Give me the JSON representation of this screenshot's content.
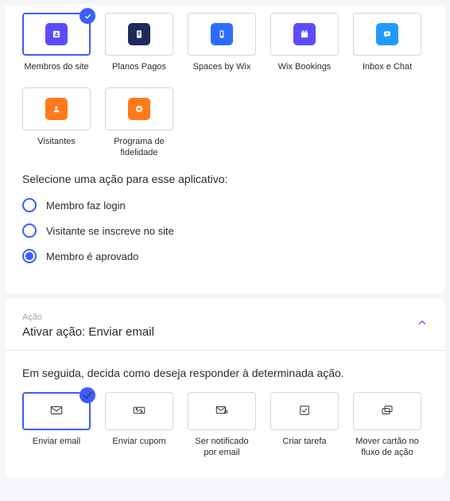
{
  "apps": {
    "title": "Selecione uma ação para esse aplicativo:",
    "items": [
      {
        "label": "Membros do site",
        "icon": "people-icon",
        "color": "bg-purple",
        "selected": true
      },
      {
        "label": "Planos Pagos",
        "icon": "doc-icon",
        "color": "bg-darkblue",
        "selected": false
      },
      {
        "label": "Spaces by Wix",
        "icon": "phone-icon",
        "color": "bg-blue",
        "selected": false
      },
      {
        "label": "Wix Bookings",
        "icon": "calendar-icon",
        "color": "bg-indigo",
        "selected": false
      },
      {
        "label": "Inbox e Chat",
        "icon": "chat-icon",
        "color": "bg-cyan",
        "selected": false
      },
      {
        "label": "Visitantes",
        "icon": "avatar-icon",
        "color": "bg-orange",
        "selected": false
      },
      {
        "label": "Programa de fidelidade",
        "icon": "badge-icon",
        "color": "bg-orange",
        "selected": false
      }
    ],
    "radios": [
      {
        "label": "Membro faz login",
        "checked": false
      },
      {
        "label": "Visitante se inscreve no site",
        "checked": false
      },
      {
        "label": "Membro é aprovado",
        "checked": true
      }
    ]
  },
  "action_panel": {
    "small": "Ação",
    "title": "Ativar ação: Enviar email",
    "prompt": "Em seguida, decida como deseja responder à determinada ação.",
    "items": [
      {
        "label": "Enviar email",
        "icon": "mail-icon",
        "selected": true
      },
      {
        "label": "Enviar cupom",
        "icon": "coupon-icon",
        "selected": false
      },
      {
        "label": "Ser notificado por email",
        "icon": "mail-alert-icon",
        "selected": false
      },
      {
        "label": "Criar tarefa",
        "icon": "task-icon",
        "selected": false
      },
      {
        "label": "Mover cartão no fluxo de ação",
        "icon": "cards-icon",
        "selected": false
      }
    ]
  }
}
